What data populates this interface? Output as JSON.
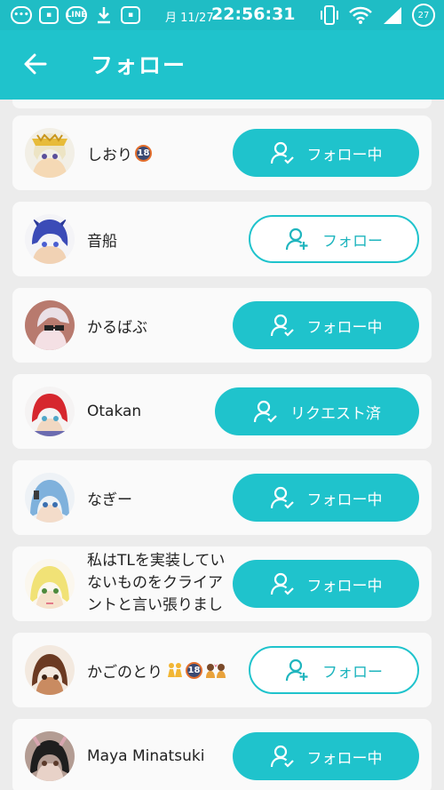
{
  "status_bar": {
    "date": "月 11/27",
    "time": "22:56:31",
    "battery": "27",
    "icon_names": [
      "chat-icon",
      "tv-icon",
      "line-icon",
      "download-icon",
      "tv-icon",
      "vibrate-icon",
      "wifi-icon",
      "signal-icon"
    ]
  },
  "app_bar": {
    "title": "フォロー",
    "back_icon": "arrow-left-icon"
  },
  "colors": {
    "accent": "#1fc3cc",
    "status_bar": "#1fbdc5",
    "card": "#fafafa",
    "background": "#ececec"
  },
  "users": [
    {
      "name": "しおり",
      "badge": "18",
      "button": "フォロー中",
      "state": "following"
    },
    {
      "name": "音船",
      "badge": "",
      "button": "フォロー",
      "state": "follow"
    },
    {
      "name": "かるばぶ",
      "badge": "",
      "button": "フォロー中",
      "state": "following"
    },
    {
      "name": "Otakan",
      "badge": "",
      "button": "リクエスト済",
      "state": "requested"
    },
    {
      "name": "なぎー",
      "badge": "",
      "button": "フォロー中",
      "state": "following"
    },
    {
      "name": "私はTLを実装していないものをクライアントと言い張りました",
      "badge": "",
      "button": "フォロー中",
      "state": "following"
    },
    {
      "name": "かごのとり",
      "badge": "18",
      "button": "フォロー",
      "state": "follow"
    },
    {
      "name": "Maya Minatsuki",
      "badge": "",
      "button": "フォロー中",
      "state": "following"
    }
  ]
}
